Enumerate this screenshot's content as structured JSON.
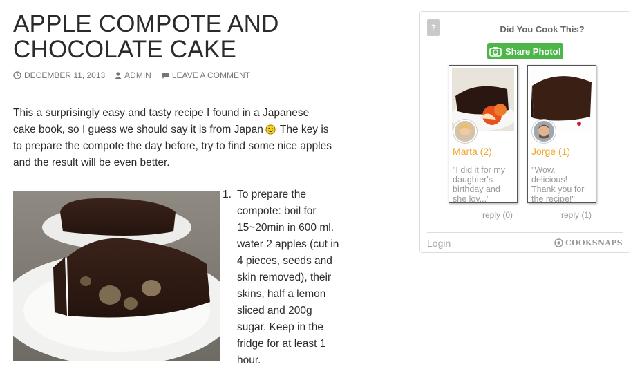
{
  "article": {
    "title_line1": "APPLE COMPOTE AND",
    "title_line2": "CHOCOLATE CAKE",
    "meta": {
      "date": "DECEMBER 11, 2013",
      "author": "ADMIN",
      "comment_link": "LEAVE A COMMENT"
    },
    "intro_before_smiley": "This a surprisingly easy and tasty recipe I found in a Japanese cake book, so I guess we should say it is from Japan",
    "intro_after_smiley": " The key is to prepare the compote the day before, try to find some nice apples and the result will be even better.",
    "steps": [
      {
        "number": "1.",
        "text": "To prepare the compote: boil for 15~20min in 600 ml. water 2 apples (cut in 4 pieces, seeds and skin removed), their skins, half a lemon sliced and 200g sugar. Keep in the fridge for at least 1 hour."
      }
    ]
  },
  "widget": {
    "help_label": "?",
    "heading": "Did You Cook This?",
    "share_button": "Share Photo!",
    "cards": [
      {
        "name": "Marta (2)",
        "quote": "\"I did it for my daughter's birthday and she lov...\"",
        "reply": "reply (0)"
      },
      {
        "name": "Jorge (1)",
        "quote": "\"Wow, delicious! Thank you for the recipe!\"",
        "reply": "reply (1)"
      }
    ],
    "login": "Login",
    "brand": "COOKSNAPS"
  },
  "colors": {
    "share_green": "#4cb648",
    "name_orange": "#f0a52a",
    "text": "#2b2b2b",
    "meta_gray": "#767676"
  },
  "icons": [
    "clock-icon",
    "user-icon",
    "comment-icon",
    "smiley-icon",
    "camera-icon",
    "cooksnaps-logo-icon"
  ]
}
